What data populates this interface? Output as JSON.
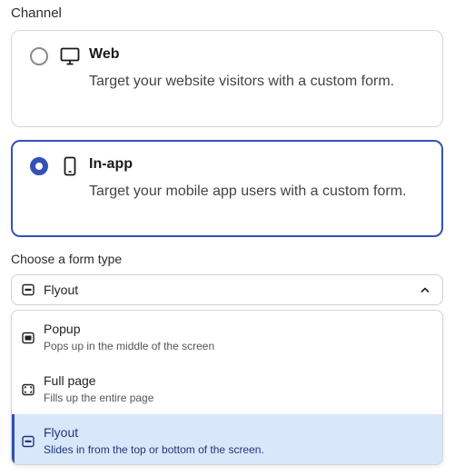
{
  "channel": {
    "label": "Channel",
    "options": [
      {
        "title": "Web",
        "description": "Target your website visitors with a custom form.",
        "icon": "monitor-icon",
        "selected": false
      },
      {
        "title": "In-app",
        "description": "Target your mobile app users with a custom form.",
        "icon": "mobile-icon",
        "selected": true
      }
    ]
  },
  "form_type": {
    "label": "Choose a form type",
    "selected_value": "Flyout",
    "options": [
      {
        "title": "Popup",
        "description": "Pops up in the middle of the screen",
        "icon": "popup-icon"
      },
      {
        "title": "Full page",
        "description": "Fills up the entire page",
        "icon": "full-page-icon"
      },
      {
        "title": "Flyout",
        "description": "Slides in from the top or bottom of the screen.",
        "icon": "flyout-icon",
        "selected": true
      }
    ]
  },
  "colors": {
    "accent": "#3352b8",
    "selected_option_bg": "#d8e7f9",
    "border": "#d6d6d6"
  }
}
